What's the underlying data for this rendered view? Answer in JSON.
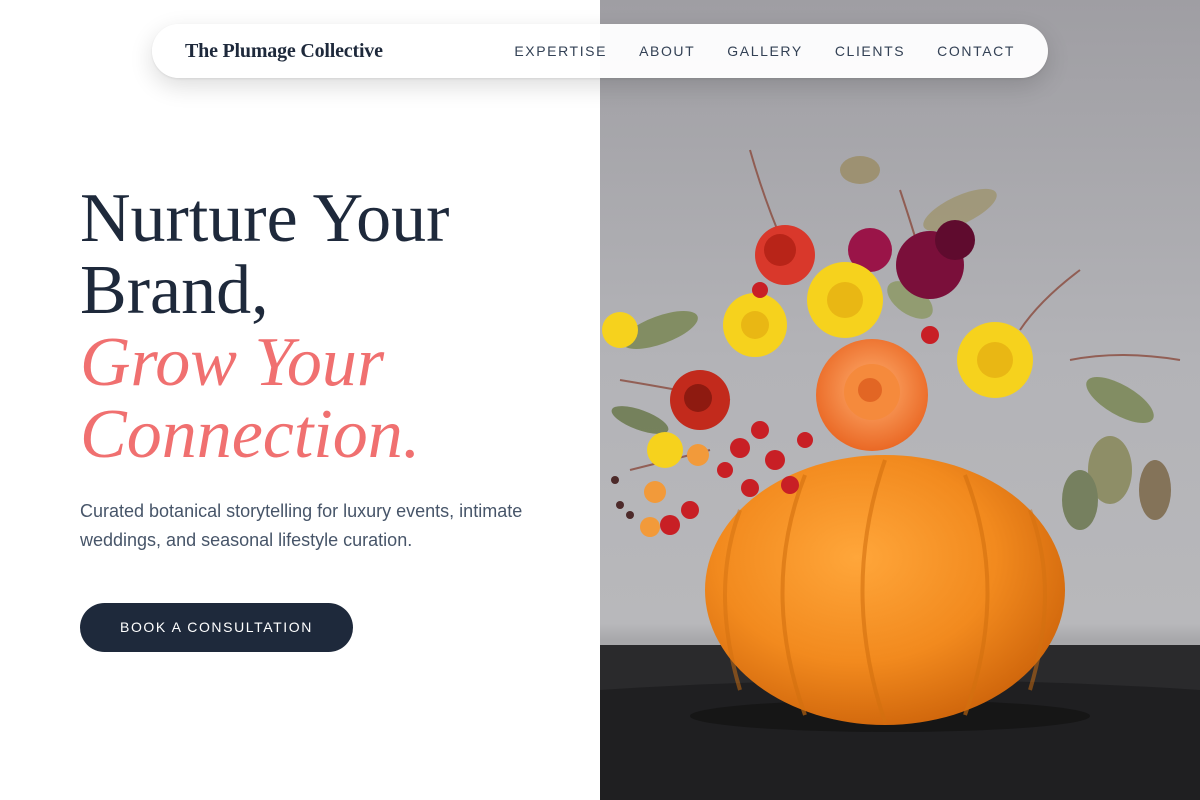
{
  "nav": {
    "brand": "The Plumage Collective",
    "links": [
      {
        "label": "EXPERTISE"
      },
      {
        "label": "ABOUT"
      },
      {
        "label": "GALLERY"
      },
      {
        "label": "CLIENTS"
      },
      {
        "label": "CONTACT"
      }
    ]
  },
  "hero": {
    "title_line1": "Nurture Your",
    "title_line2": "Brand,",
    "title_line3": "Grow Your",
    "title_line4": "Connection.",
    "subtitle": "Curated botanical storytelling for luxury events, intimate weddings, and seasonal lifestyle curation.",
    "cta_label": "BOOK A CONSULTATION"
  },
  "image": {
    "subject": "pumpkin-floral-arrangement"
  },
  "colors": {
    "dark": "#1e293b",
    "accent": "#f07070",
    "body_text": "#475569",
    "pumpkin": "#f28a1e"
  }
}
